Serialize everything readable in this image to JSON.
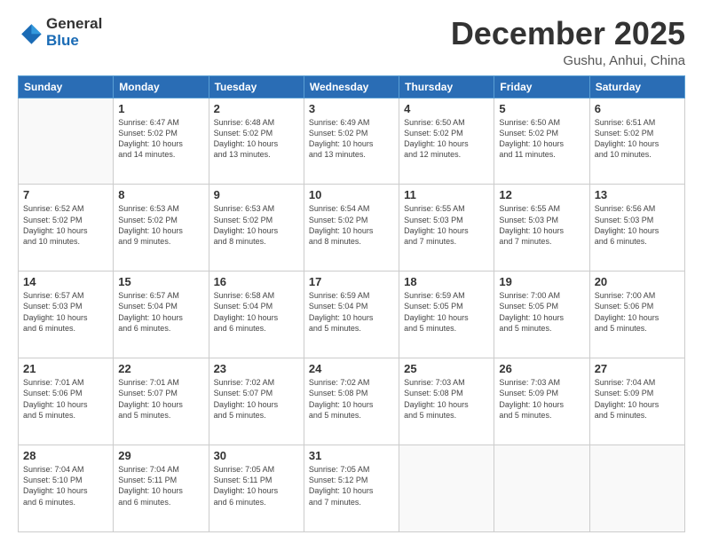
{
  "logo": {
    "general": "General",
    "blue": "Blue"
  },
  "header": {
    "month": "December 2025",
    "location": "Gushu, Anhui, China"
  },
  "weekdays": [
    "Sunday",
    "Monday",
    "Tuesday",
    "Wednesday",
    "Thursday",
    "Friday",
    "Saturday"
  ],
  "weeks": [
    [
      {
        "day": "",
        "info": ""
      },
      {
        "day": "1",
        "info": "Sunrise: 6:47 AM\nSunset: 5:02 PM\nDaylight: 10 hours\nand 14 minutes."
      },
      {
        "day": "2",
        "info": "Sunrise: 6:48 AM\nSunset: 5:02 PM\nDaylight: 10 hours\nand 13 minutes."
      },
      {
        "day": "3",
        "info": "Sunrise: 6:49 AM\nSunset: 5:02 PM\nDaylight: 10 hours\nand 13 minutes."
      },
      {
        "day": "4",
        "info": "Sunrise: 6:50 AM\nSunset: 5:02 PM\nDaylight: 10 hours\nand 12 minutes."
      },
      {
        "day": "5",
        "info": "Sunrise: 6:50 AM\nSunset: 5:02 PM\nDaylight: 10 hours\nand 11 minutes."
      },
      {
        "day": "6",
        "info": "Sunrise: 6:51 AM\nSunset: 5:02 PM\nDaylight: 10 hours\nand 10 minutes."
      }
    ],
    [
      {
        "day": "7",
        "info": "Sunrise: 6:52 AM\nSunset: 5:02 PM\nDaylight: 10 hours\nand 10 minutes."
      },
      {
        "day": "8",
        "info": "Sunrise: 6:53 AM\nSunset: 5:02 PM\nDaylight: 10 hours\nand 9 minutes."
      },
      {
        "day": "9",
        "info": "Sunrise: 6:53 AM\nSunset: 5:02 PM\nDaylight: 10 hours\nand 8 minutes."
      },
      {
        "day": "10",
        "info": "Sunrise: 6:54 AM\nSunset: 5:02 PM\nDaylight: 10 hours\nand 8 minutes."
      },
      {
        "day": "11",
        "info": "Sunrise: 6:55 AM\nSunset: 5:03 PM\nDaylight: 10 hours\nand 7 minutes."
      },
      {
        "day": "12",
        "info": "Sunrise: 6:55 AM\nSunset: 5:03 PM\nDaylight: 10 hours\nand 7 minutes."
      },
      {
        "day": "13",
        "info": "Sunrise: 6:56 AM\nSunset: 5:03 PM\nDaylight: 10 hours\nand 6 minutes."
      }
    ],
    [
      {
        "day": "14",
        "info": "Sunrise: 6:57 AM\nSunset: 5:03 PM\nDaylight: 10 hours\nand 6 minutes."
      },
      {
        "day": "15",
        "info": "Sunrise: 6:57 AM\nSunset: 5:04 PM\nDaylight: 10 hours\nand 6 minutes."
      },
      {
        "day": "16",
        "info": "Sunrise: 6:58 AM\nSunset: 5:04 PM\nDaylight: 10 hours\nand 6 minutes."
      },
      {
        "day": "17",
        "info": "Sunrise: 6:59 AM\nSunset: 5:04 PM\nDaylight: 10 hours\nand 5 minutes."
      },
      {
        "day": "18",
        "info": "Sunrise: 6:59 AM\nSunset: 5:05 PM\nDaylight: 10 hours\nand 5 minutes."
      },
      {
        "day": "19",
        "info": "Sunrise: 7:00 AM\nSunset: 5:05 PM\nDaylight: 10 hours\nand 5 minutes."
      },
      {
        "day": "20",
        "info": "Sunrise: 7:00 AM\nSunset: 5:06 PM\nDaylight: 10 hours\nand 5 minutes."
      }
    ],
    [
      {
        "day": "21",
        "info": "Sunrise: 7:01 AM\nSunset: 5:06 PM\nDaylight: 10 hours\nand 5 minutes."
      },
      {
        "day": "22",
        "info": "Sunrise: 7:01 AM\nSunset: 5:07 PM\nDaylight: 10 hours\nand 5 minutes."
      },
      {
        "day": "23",
        "info": "Sunrise: 7:02 AM\nSunset: 5:07 PM\nDaylight: 10 hours\nand 5 minutes."
      },
      {
        "day": "24",
        "info": "Sunrise: 7:02 AM\nSunset: 5:08 PM\nDaylight: 10 hours\nand 5 minutes."
      },
      {
        "day": "25",
        "info": "Sunrise: 7:03 AM\nSunset: 5:08 PM\nDaylight: 10 hours\nand 5 minutes."
      },
      {
        "day": "26",
        "info": "Sunrise: 7:03 AM\nSunset: 5:09 PM\nDaylight: 10 hours\nand 5 minutes."
      },
      {
        "day": "27",
        "info": "Sunrise: 7:04 AM\nSunset: 5:09 PM\nDaylight: 10 hours\nand 5 minutes."
      }
    ],
    [
      {
        "day": "28",
        "info": "Sunrise: 7:04 AM\nSunset: 5:10 PM\nDaylight: 10 hours\nand 6 minutes."
      },
      {
        "day": "29",
        "info": "Sunrise: 7:04 AM\nSunset: 5:11 PM\nDaylight: 10 hours\nand 6 minutes."
      },
      {
        "day": "30",
        "info": "Sunrise: 7:05 AM\nSunset: 5:11 PM\nDaylight: 10 hours\nand 6 minutes."
      },
      {
        "day": "31",
        "info": "Sunrise: 7:05 AM\nSunset: 5:12 PM\nDaylight: 10 hours\nand 7 minutes."
      },
      {
        "day": "",
        "info": ""
      },
      {
        "day": "",
        "info": ""
      },
      {
        "day": "",
        "info": ""
      }
    ]
  ]
}
